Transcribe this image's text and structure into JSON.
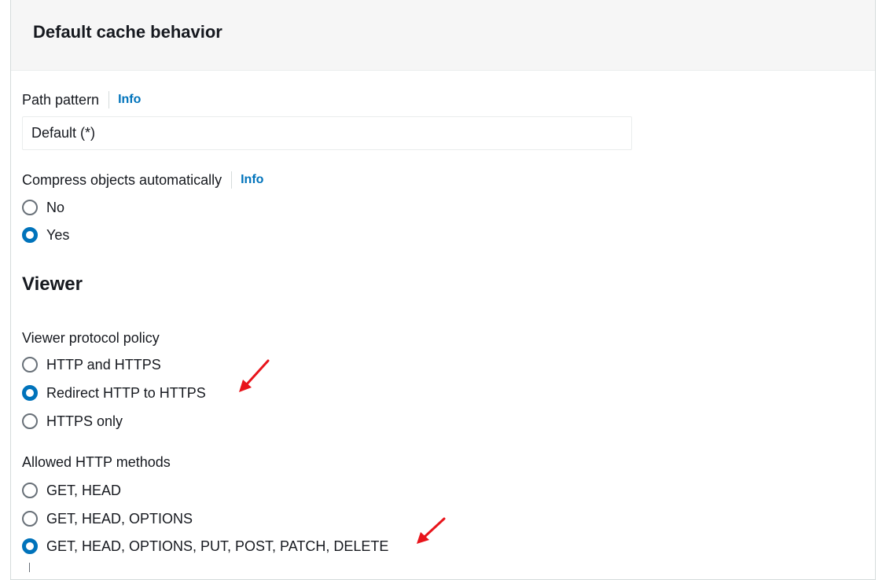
{
  "panel": {
    "title": "Default cache behavior"
  },
  "path_pattern": {
    "label": "Path pattern",
    "info": "Info",
    "value": "Default (*)"
  },
  "compress": {
    "label": "Compress objects automatically",
    "info": "Info",
    "options": [
      {
        "label": "No",
        "checked": false
      },
      {
        "label": "Yes",
        "checked": true
      }
    ]
  },
  "viewer": {
    "heading": "Viewer",
    "protocol_policy": {
      "label": "Viewer protocol policy",
      "options": [
        {
          "label": "HTTP and HTTPS",
          "checked": false
        },
        {
          "label": "Redirect HTTP to HTTPS",
          "checked": true
        },
        {
          "label": "HTTPS only",
          "checked": false
        }
      ]
    },
    "allowed_methods": {
      "label": "Allowed HTTP methods",
      "options": [
        {
          "label": "GET, HEAD",
          "checked": false
        },
        {
          "label": "GET, HEAD, OPTIONS",
          "checked": false
        },
        {
          "label": "GET, HEAD, OPTIONS, PUT, POST, PATCH, DELETE",
          "checked": true
        }
      ]
    }
  },
  "colors": {
    "accent": "#0073bb",
    "annotation_arrow": "#e8141b"
  },
  "icons": {
    "annotation": "red-arrow-icon"
  }
}
